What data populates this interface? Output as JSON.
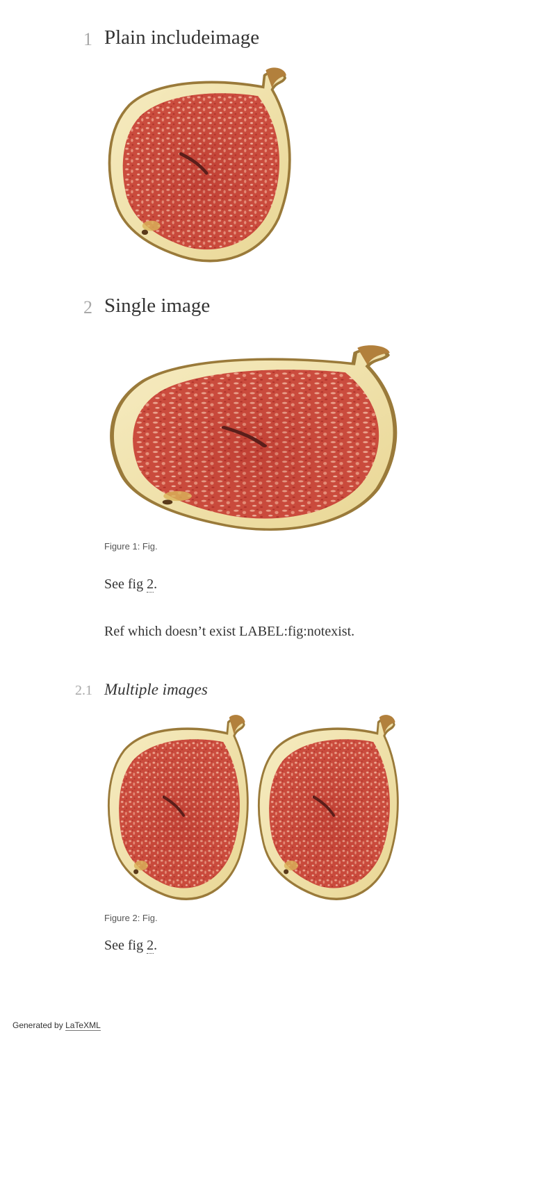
{
  "section1": {
    "number": "1",
    "title": "Plain includeimage"
  },
  "section2": {
    "number": "2",
    "title": "Single image"
  },
  "figure1": {
    "caption": "Figure 1: Fig."
  },
  "para_see_fig_1": {
    "prefix": "See fig ",
    "ref": "2",
    "suffix": "."
  },
  "para_missing_ref": {
    "text": "Ref which doesn’t exist LABEL:fig:notexist."
  },
  "subsection21": {
    "number": "2.1",
    "title": "Multiple images"
  },
  "figure2": {
    "caption": "Figure 2: Fig."
  },
  "para_see_fig_2": {
    "prefix": "See fig ",
    "ref": "2",
    "suffix": "."
  },
  "footer": {
    "prefix": "Generated by ",
    "link": "LaTeXML"
  },
  "images": {
    "subject": "fig-fruit-half"
  },
  "colors": {
    "rind": "#efe1a8",
    "rind_edge": "#9a7a3a",
    "flesh": "#c94a3c",
    "flesh_dark": "#a42a24",
    "seed": "#f3c1a8",
    "stem": "#b2803c"
  }
}
